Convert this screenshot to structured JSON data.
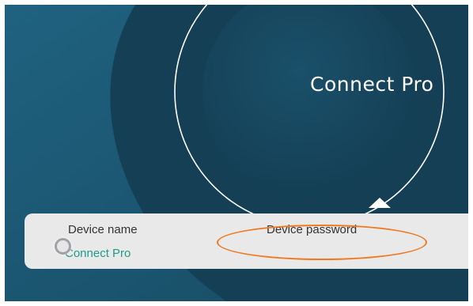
{
  "header": {
    "title": "Connect Pro"
  },
  "info_panel": {
    "device_name_label": "Device name",
    "device_name_value": "Connect Pro",
    "device_password_label": "Device password",
    "device_password_value": ""
  },
  "icons": {
    "collapse": "triangle-up-icon",
    "touch": "touch-indicator-icon"
  },
  "colors": {
    "background": "#1c5872",
    "panel": "#e9e9ea",
    "accent_text": "#1e9c87",
    "highlight": "#f07a22"
  }
}
